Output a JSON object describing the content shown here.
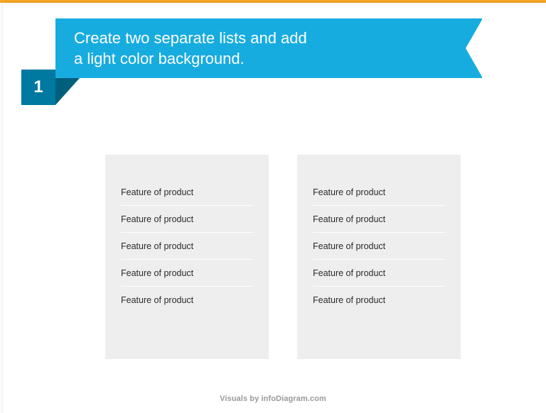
{
  "header": {
    "title_line1": "Create two separate lists and add",
    "title_line2": "a light color background.",
    "step_number": "1"
  },
  "lists": {
    "left": [
      "Feature of product",
      "Feature of product",
      "Feature of product",
      "Feature of product",
      "Feature of product"
    ],
    "right": [
      "Feature of product",
      "Feature of product",
      "Feature of product",
      "Feature of product",
      "Feature of product"
    ]
  },
  "footer": {
    "credit": "Visuals by infoDiagram.com"
  }
}
